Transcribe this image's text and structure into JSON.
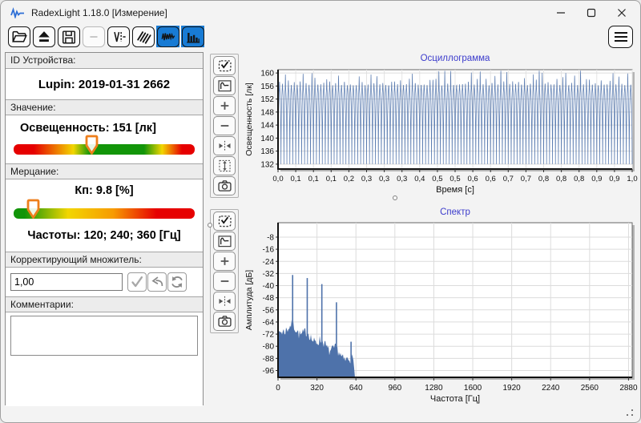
{
  "window": {
    "title": "RadexLight 1.18.0 [Измерение]"
  },
  "window_controls": [
    {
      "name": "minimize",
      "icon": "minimize-icon"
    },
    {
      "name": "maximize",
      "icon": "maximize-icon"
    },
    {
      "name": "close",
      "icon": "close-icon"
    }
  ],
  "toolbar": {
    "active_color": "#187bd4",
    "buttons": [
      {
        "name": "open",
        "icon": "open-folder-icon",
        "state": "normal"
      },
      {
        "name": "eject",
        "icon": "eject-icon",
        "state": "normal"
      },
      {
        "name": "save",
        "icon": "save-icon",
        "state": "normal"
      },
      {
        "name": "disconnected-action",
        "icon": "dash-icon",
        "state": "disabled"
      },
      {
        "name": "signal",
        "icon": "pulse-icon",
        "state": "normal"
      },
      {
        "name": "light-rays",
        "icon": "rays-icon",
        "state": "normal"
      },
      {
        "name": "oscillogram-view",
        "icon": "wave-icon",
        "state": "active"
      },
      {
        "name": "spectrum-view",
        "icon": "bars-icon",
        "state": "active"
      }
    ]
  },
  "menu_button": {
    "name": "menu",
    "icon": "hamburger-icon"
  },
  "left_panel": {
    "device_section": {
      "label": "ID Устройства:",
      "value": "Lupin: 2019-01-31 2662"
    },
    "value_section": {
      "label": "Значение:",
      "reading": "Освещенность: 151 [лк]",
      "slider_pct": 43,
      "scale_colors": [
        "#e60000",
        "#f2d600",
        "#129509",
        "#f2d600",
        "#e60000"
      ]
    },
    "flicker_section": {
      "label": "Мерцание:",
      "kp": "Кп: 9.8 [%]",
      "frequencies": "Частоты: 120; 240; 360 [Гц]",
      "slider_pct": 11,
      "scale_colors": [
        "#129509",
        "#f2d600",
        "#f79b00",
        "#e60000"
      ]
    },
    "multiplier_section": {
      "label": "Корректирующий множитель:",
      "value": "1,00",
      "buttons": [
        {
          "name": "apply",
          "icon": "check-icon"
        },
        {
          "name": "undo",
          "icon": "undo-icon"
        },
        {
          "name": "refresh",
          "icon": "refresh-icon"
        }
      ]
    },
    "comments_section": {
      "label": "Комментарии:",
      "value": ""
    }
  },
  "marker_color": "#ee7f1c",
  "chart_tools": [
    {
      "name": "oscillogram-tools",
      "buttons": [
        "select-region",
        "autoscale",
        "zoom-in",
        "zoom-out",
        "fit-horizontal",
        "fit-vertical",
        "snapshot"
      ]
    },
    {
      "name": "spectrum-tools",
      "buttons": [
        "select-region",
        "autoscale",
        "zoom-in",
        "zoom-out",
        "fit-horizontal",
        "snapshot"
      ]
    }
  ],
  "chart_data": [
    {
      "type": "line",
      "title": "Осциллограмма",
      "title_color": "#3c3ccc",
      "xlabel": "Время [с]",
      "ylabel": "Освещенность [лк]",
      "xlim": [
        0,
        1
      ],
      "ylim": [
        130.5,
        161
      ],
      "yticks": [
        160,
        156,
        152,
        148,
        144,
        140,
        136,
        132
      ],
      "xtick_labels": [
        "0,0",
        "0,1",
        "0,1",
        "0,1",
        "0,2",
        "0,3",
        "0,3",
        "0,3",
        "0,4",
        "0,5",
        "0,5",
        "0,6",
        "0,6",
        "0,7",
        "0,7",
        "0,8",
        "0,8",
        "0,8",
        "0,9",
        "0,9",
        "1,0"
      ],
      "grid": true,
      "line_color": "#4e72aa",
      "signal": {
        "shape": "rectified-sine-flicker",
        "fundamental_hz": 120,
        "duration_s": 1.0,
        "min": 132,
        "plateau": 155,
        "peak_max": 160,
        "mean": 151
      }
    },
    {
      "type": "area",
      "title": "Спектр",
      "title_color": "#3c3ccc",
      "xlabel": "Частота [Гц]",
      "ylabel": "Амплитуда [дБ]",
      "xlim": [
        0,
        2910
      ],
      "ylim": [
        -100.5,
        1.5
      ],
      "yticks": [
        -8,
        -16,
        -24,
        -32,
        -40,
        -48,
        -56,
        -64,
        -72,
        -80,
        -88,
        -96
      ],
      "xticks": [
        0,
        320,
        640,
        960,
        1280,
        1600,
        1920,
        2240,
        2560,
        2880
      ],
      "grid": true,
      "fill_color": "#4e72aa",
      "peaks": [
        [
          120,
          -33
        ],
        [
          240,
          -35
        ],
        [
          360,
          -39
        ],
        [
          480,
          -51
        ],
        [
          600,
          -77
        ]
      ],
      "noise_floor": {
        "start_db": -71,
        "end_db": -98,
        "cutoff_hz": 630
      }
    }
  ]
}
